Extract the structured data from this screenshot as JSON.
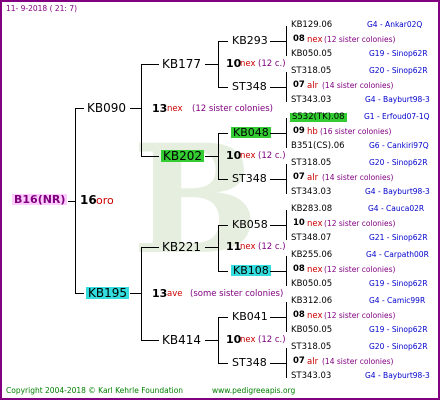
{
  "header": {
    "date": "11- 9-2018 ( 21: 7)"
  },
  "footer": {
    "copyright": "Copyright 2004-2018 © Karl Kehrle Foundation",
    "url": "www.pedigreeapis.org"
  },
  "root": {
    "id": "B16(NR)",
    "gen": "16",
    "race": "oro"
  },
  "gen1": [
    {
      "id": "KB090",
      "gen": "13",
      "race": "nex",
      "note": "(12 sister colonies)"
    },
    {
      "id": "KB195",
      "gen": "13",
      "race": "ave",
      "note": "(some sister colonies)"
    }
  ],
  "gen2": [
    {
      "id": "KB177",
      "gen": "",
      "race": "",
      "note": ""
    },
    {
      "id": "KB202",
      "gen": "10",
      "race": "nex",
      "note": "(12 c.)"
    },
    {
      "id": "KB221",
      "gen": "11",
      "race": "nex",
      "note": "(12 c.)"
    },
    {
      "id": "KB414",
      "gen": "10",
      "race": "nex",
      "note": "(12 c.)"
    }
  ],
  "gen3": [
    {
      "id": "KB293",
      "gen": "10",
      "race": "nex",
      "note": "(12 c.)"
    },
    {
      "id": "ST348",
      "gen": "",
      "race": "",
      "note": ""
    },
    {
      "id": "KB048",
      "gen": "",
      "race": "",
      "note": ""
    },
    {
      "id": "ST348",
      "gen": "",
      "race": "",
      "note": ""
    },
    {
      "id": "KB058",
      "gen": "",
      "race": "",
      "note": ""
    },
    {
      "id": "KB108",
      "gen": "",
      "race": "",
      "note": ""
    },
    {
      "id": "KB041",
      "gen": "",
      "race": "",
      "note": ""
    },
    {
      "id": "ST348",
      "gen": "",
      "race": "",
      "note": ""
    }
  ],
  "gen4": [
    {
      "id": "KB129.06",
      "breeder": "G4 - Ankar02Q"
    },
    {
      "mid_gen": "08",
      "mid_race": "nex",
      "mid_note": "(12 sister colonies)"
    },
    {
      "id": "KB050.05",
      "breeder": "G19 - Sinop62R"
    },
    {
      "id": "ST318.05",
      "breeder": "G20 - Sinop62R"
    },
    {
      "mid_gen": "07",
      "mid_race": "alr",
      "mid_note": "(14 sister colonies)"
    },
    {
      "id": "ST343.03",
      "breeder": "G4 - Bayburt98-3"
    },
    {
      "id": "S532(TK).08",
      "breeder": "G1 - Erfoud07-1Q"
    },
    {
      "mid_gen": "09",
      "mid_race": "hb",
      "mid_note": "(16 sister colonies)"
    },
    {
      "id": "B351(CS).06",
      "breeder": "G6 - Cankiri97Q"
    },
    {
      "id": "ST318.05",
      "breeder": "G20 - Sinop62R"
    },
    {
      "mid_gen": "07",
      "mid_race": "alr",
      "mid_note": "(14 sister colonies)"
    },
    {
      "id": "ST343.03",
      "breeder": "G4 - Bayburt98-3"
    },
    {
      "id": "KB283.08",
      "breeder": "G4 - Cauca02R"
    },
    {
      "mid_gen": "10",
      "mid_race": "nex",
      "mid_note": "(12 sister colonies)"
    },
    {
      "id": "ST348.07",
      "breeder": "G21 - Sinop62R"
    },
    {
      "id": "KB255.06",
      "breeder": "G4 - Carpath00R"
    },
    {
      "mid_gen": "08",
      "mid_race": "nex",
      "mid_note": "(12 sister colonies)"
    },
    {
      "id": "KB050.05",
      "breeder": "G19 - Sinop62R"
    },
    {
      "id": "KB312.06",
      "breeder": "G4 - Camic99R"
    },
    {
      "mid_gen": "08",
      "mid_race": "nex",
      "mid_note": "(12 sister colonies)"
    },
    {
      "id": "KB050.05",
      "breeder": "G19 - Sinop62R"
    },
    {
      "id": "ST318.05",
      "breeder": "G20 - Sinop62R"
    },
    {
      "mid_gen": "07",
      "mid_race": "alr",
      "mid_note": "(14 sister colonies)"
    },
    {
      "id": "ST343.03",
      "breeder": "G4 - Bayburt98-3"
    }
  ],
  "colors": {
    "frame": "#800080",
    "race": "#cc0000",
    "breeder": "#0000cc",
    "footer": "#008000",
    "highlight_green": "#33cc33",
    "highlight_cyan": "#33dddd"
  }
}
